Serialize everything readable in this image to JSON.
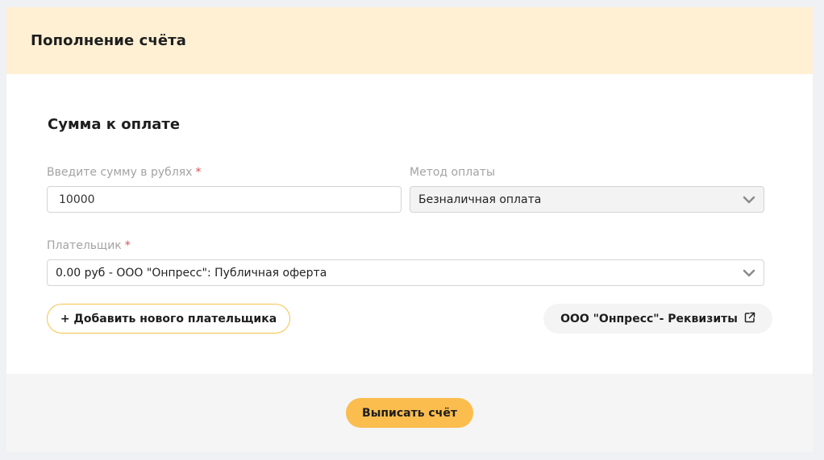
{
  "header": {
    "title": "Пополнение счёта"
  },
  "section": {
    "title": "Сумма к оплате"
  },
  "amount": {
    "label": "Введите сумму в рублях",
    "required_mark": "*",
    "value": "10000"
  },
  "payment_method": {
    "label": "Метод оплаты",
    "selected": "Безналичная оплата"
  },
  "payer": {
    "label": "Плательщик",
    "required_mark": "*",
    "selected": "0.00 руб - ООО \"Онпресс\": Публичная оферта"
  },
  "buttons": {
    "add_payer": "+ Добавить нового плательщика",
    "requisites": "ООО \"Онпресс\"- Реквизиты",
    "submit": "Выписать счёт"
  },
  "icons": {
    "dropdown": "chevron-down-icon",
    "external": "external-link-icon"
  },
  "colors": {
    "header_bg": "#fff0d4",
    "accent": "#fbbd4e",
    "outline": "#f5c34a",
    "required": "#d9534f"
  }
}
